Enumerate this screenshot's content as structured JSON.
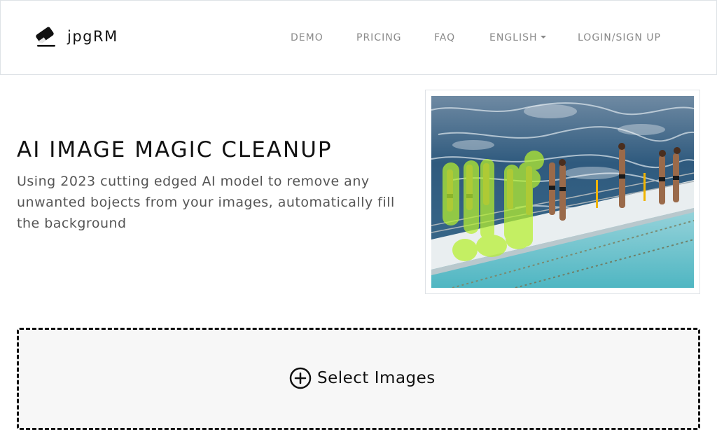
{
  "brand": {
    "name": "jpgRM",
    "icon": "eraser-icon"
  },
  "nav": {
    "demo": "DEMO",
    "pricing": "PRICING",
    "faq": "FAQ",
    "language": "ENGLISH",
    "login": "LOGIN/SIGN UP"
  },
  "hero": {
    "title": "AI IMAGE MAGIC CLEANUP",
    "description": "Using 2023 cutting edged AI model to remove any unwanted bojects from your images, automatically fill the background"
  },
  "upload": {
    "label": "Select Images",
    "icon": "plus-circle-icon"
  },
  "colors": {
    "mask": "#b7f02e",
    "ocean": "#2f5a7e",
    "pool": "#4fb6c2",
    "deck": "#e9eef0"
  }
}
